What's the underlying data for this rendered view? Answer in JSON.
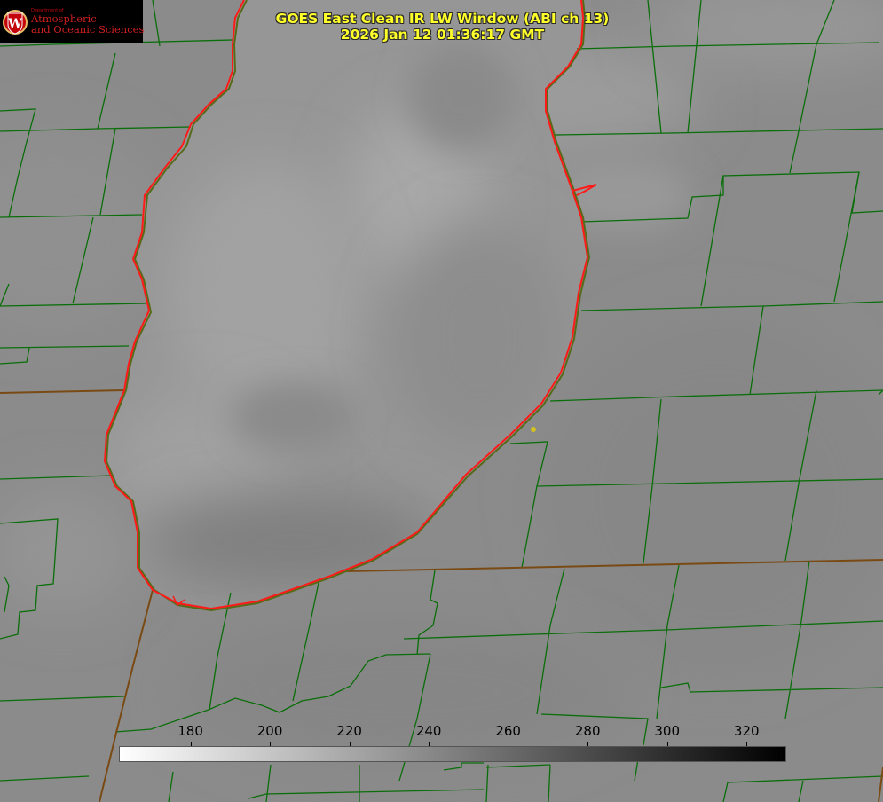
{
  "header": {
    "title_line1": "GOES East Clean IR LW Window (ABI ch 13)",
    "title_line2": "2026 Jan 12 01:36:17 GMT"
  },
  "logo": {
    "emblem_letter": "W",
    "department": "Department of",
    "line1": "Atmospheric",
    "line2": "and Oceanic Sciences"
  },
  "colorbar": {
    "min": 162,
    "max": 330,
    "ticks": [
      "180",
      "200",
      "220",
      "240",
      "260",
      "280",
      "300",
      "320"
    ],
    "color_low": "#ffffff",
    "color_high": "#000000"
  },
  "map": {
    "lake_outline_color": "#ff0000",
    "boundary_color": "#0a6e0a",
    "marker_color": "#d4c21e"
  }
}
